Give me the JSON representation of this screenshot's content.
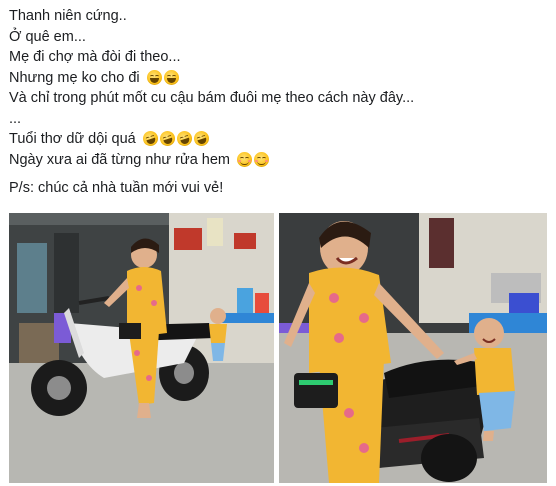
{
  "post": {
    "lines": [
      "Thanh niên cứng..",
      "Ở quê em...",
      "Mẹ đi chợ mà đòi đi theo...",
      "Nhưng mẹ ko cho đi",
      "Và chỉ trong phút mốt cu cậu bám đuôi mẹ theo cách này đây...",
      "...",
      "Tuổi thơ dữ dội quá",
      "Ngày xưa ai đã từng như rửa hem",
      "P/s: chúc cả nhà tuần mới vui vẻ!"
    ],
    "emoji": {
      "line_4": "joy-emoji x2",
      "line_7": "rolling-on-floor-laughing-emoji x4",
      "line_8": "blush-emoji x2"
    }
  },
  "photos": [
    {
      "name": "photo-left",
      "description_icon": "photo-icon"
    },
    {
      "name": "photo-right",
      "description_icon": "photo-icon"
    }
  ],
  "colors": {
    "text": "#1c1e21",
    "dress": "#f2b632",
    "emoji": "#fcc21b"
  }
}
